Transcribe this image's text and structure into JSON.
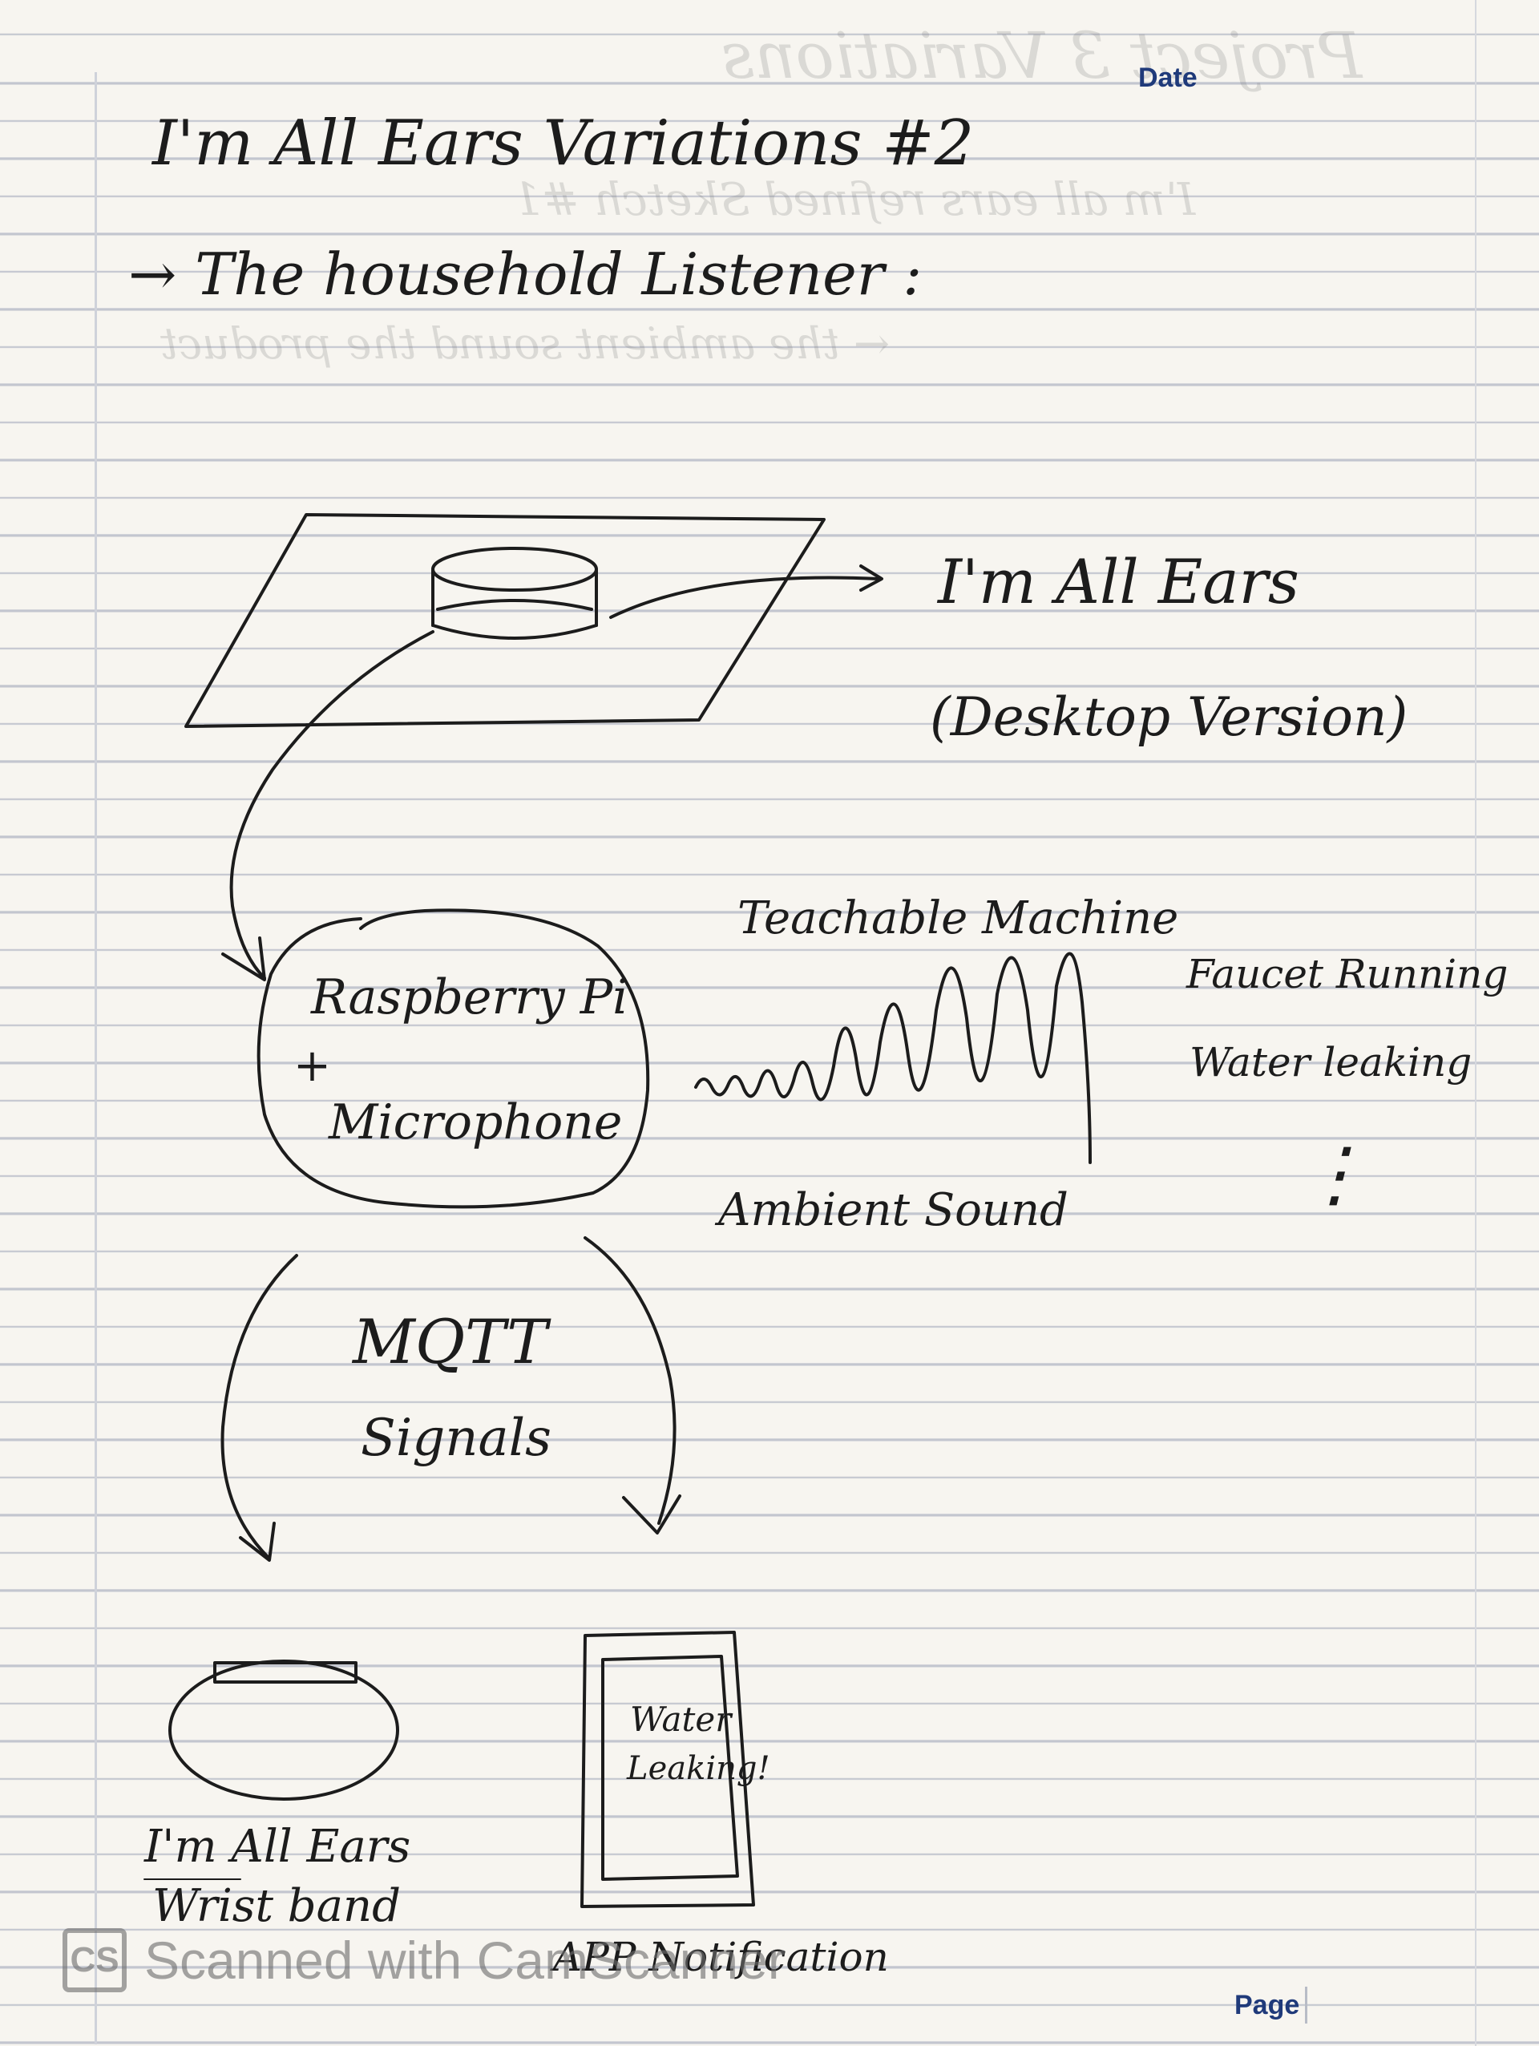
{
  "header": {
    "date_label": "Date",
    "page_label": "Page"
  },
  "note": {
    "title": "I'm All Ears Variations #2",
    "subtitle": "→ The household Listener :",
    "desktop_label_line1": "I'm All Ears",
    "desktop_label_line2": "(Desktop Version)",
    "device_line1": "Raspberry Pi",
    "device_line2": "+",
    "device_line3": "Microphone",
    "wave_top_label": "Teachable Machine",
    "wave_bottom_label": "Ambient Sound",
    "detect_line1": "Faucet Running",
    "detect_line2": "Water leaking",
    "detect_more": "⋮",
    "mqtt_line1": "MQTT",
    "mqtt_line2": "Signals",
    "phone_screen_line1": "Water",
    "phone_screen_line2": "Leaking!",
    "wristband_label_line1": "I'm All Ears",
    "wristband_label_line2": "Wrist band",
    "phone_label": "APP Notification"
  },
  "ghost_text": {
    "line1": "Project 3 Variations",
    "line2": "I'm all ears refined Sketch #1",
    "line3": "← the ambient sound the product"
  },
  "watermark": {
    "logo": "CS",
    "text": "Scanned with CamScanner"
  }
}
